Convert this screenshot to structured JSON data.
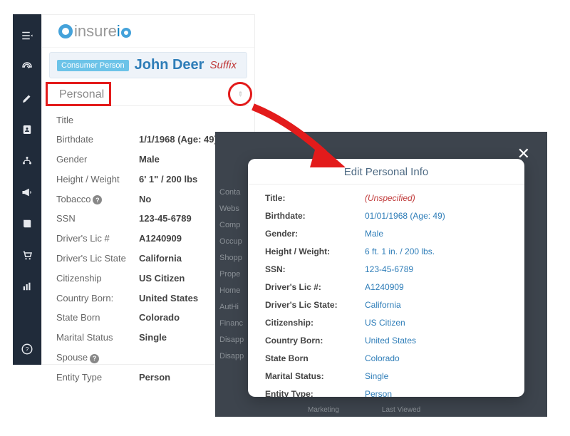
{
  "logo": {
    "prefix": "insure",
    "suffix_io": "i"
  },
  "badge": "Consumer Person",
  "person": {
    "name": "John Deer",
    "suffix": "Suffix"
  },
  "section_title": "Personal",
  "fields": {
    "title": {
      "label": "Title",
      "value": ""
    },
    "birthdate": {
      "label": "Birthdate",
      "value": "1/1/1968 (Age: 49)"
    },
    "gender": {
      "label": "Gender",
      "value": "Male"
    },
    "height": {
      "label": "Height / Weight",
      "value": "6' 1\" / 200 lbs"
    },
    "tobacco": {
      "label": "Tobacco",
      "value": "No"
    },
    "ssn": {
      "label": "SSN",
      "value": "123-45-6789"
    },
    "licnum": {
      "label": "Driver's Lic #",
      "value": "A1240909"
    },
    "licstate": {
      "label": "Driver's Lic State",
      "value": "California"
    },
    "citizen": {
      "label": "Citizenship",
      "value": "US Citizen"
    },
    "cborn": {
      "label": "Country Born:",
      "value": "United States"
    },
    "sborn": {
      "label": "State Born",
      "value": "Colorado"
    },
    "marital": {
      "label": "Marital Status",
      "value": "Single"
    },
    "spouse": {
      "label": "Spouse",
      "value": ""
    },
    "etype": {
      "label": "Entity Type",
      "value": "Person"
    }
  },
  "modal": {
    "title": "Edit Personal Info",
    "rows": {
      "title": {
        "label": "Title:",
        "value": "(Unspecified)"
      },
      "birthdate": {
        "label": "Birthdate:",
        "value": "01/01/1968 (Age: 49)"
      },
      "gender": {
        "label": "Gender:",
        "value": "Male"
      },
      "height": {
        "label": "Height / Weight:",
        "value": "6 ft. 1 in. / 200 lbs."
      },
      "ssn": {
        "label": "SSN:",
        "value": "123-45-6789"
      },
      "licnum": {
        "label": "Driver's Lic #:",
        "value": "A1240909"
      },
      "licstate": {
        "label": "Driver's Lic State:",
        "value": "California"
      },
      "citizen": {
        "label": "Citizenship:",
        "value": "US Citizen"
      },
      "cborn": {
        "label": "Country Born:",
        "value": "United States"
      },
      "sborn": {
        "label": "State Born",
        "value": "Colorado"
      },
      "marital": {
        "label": "Marital Status:",
        "value": "Single"
      },
      "etype": {
        "label": "Entity Type:",
        "value": "Person"
      }
    }
  },
  "bg_lines": [
    "Conta",
    "Webs",
    "Comp",
    "Occup",
    "Shopp",
    "Prope",
    "Home",
    "AutHi",
    "",
    "Financ",
    "",
    "Disapp",
    "Disapp"
  ],
  "bg_bottom": [
    "Marketing",
    "Last Viewed"
  ]
}
